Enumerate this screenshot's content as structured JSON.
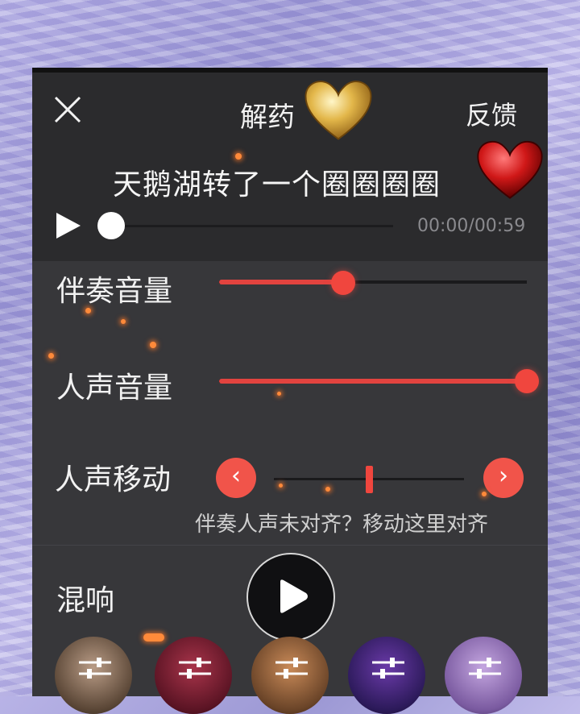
{
  "header": {
    "title": "解药",
    "feedback_label": "反馈"
  },
  "song": {
    "name": "天鹅湖转了一个圈圈圈圈",
    "time_display": "00:00/00:59",
    "progress": 0.0
  },
  "controls": {
    "accompaniment_volume": {
      "label": "伴奏音量",
      "level": 0.4
    },
    "vocal_volume": {
      "label": "人声音量",
      "level": 1.0
    },
    "vocal_shift": {
      "label": "人声移动",
      "left_glyph": "‹",
      "right_glyph": "›",
      "hint": "伴奏人声未对齐？移动这里对齐"
    },
    "reverb": {
      "label": "混响"
    }
  },
  "colors": {
    "accent": "#f0463e",
    "panel": "#2b2b2d",
    "panel_body": "#37373a"
  },
  "icons": [
    "close-icon",
    "play-icon",
    "big-play-icon",
    "gold-heart-icon",
    "red-heart-icon",
    "equalizer-icon"
  ]
}
